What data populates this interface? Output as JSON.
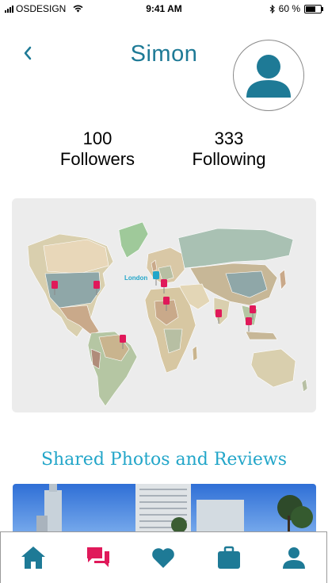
{
  "status_bar": {
    "carrier": "OSDESIGN",
    "time": "9:41 AM",
    "battery": "60 %"
  },
  "header": {
    "title": "Simon"
  },
  "stats": {
    "followers": {
      "count": "100",
      "label": "Followers"
    },
    "following": {
      "count": "333",
      "label": "Following"
    }
  },
  "map": {
    "highlight_label": "London",
    "pin_color": "#e0195a",
    "highlight_color": "#23a6c9"
  },
  "section": {
    "title": "Shared Photos and Reviews"
  },
  "tabs": [
    {
      "icon": "home-icon",
      "color": "#1e7a96"
    },
    {
      "icon": "chat-icon",
      "color": "#e0195a"
    },
    {
      "icon": "heart-icon",
      "color": "#1e7a96"
    },
    {
      "icon": "briefcase-icon",
      "color": "#1e7a96"
    },
    {
      "icon": "person-icon",
      "color": "#1e7a96"
    }
  ],
  "colors": {
    "accent": "#1e7a96",
    "section_title": "#23a6c9",
    "active_tab": "#e0195a"
  }
}
